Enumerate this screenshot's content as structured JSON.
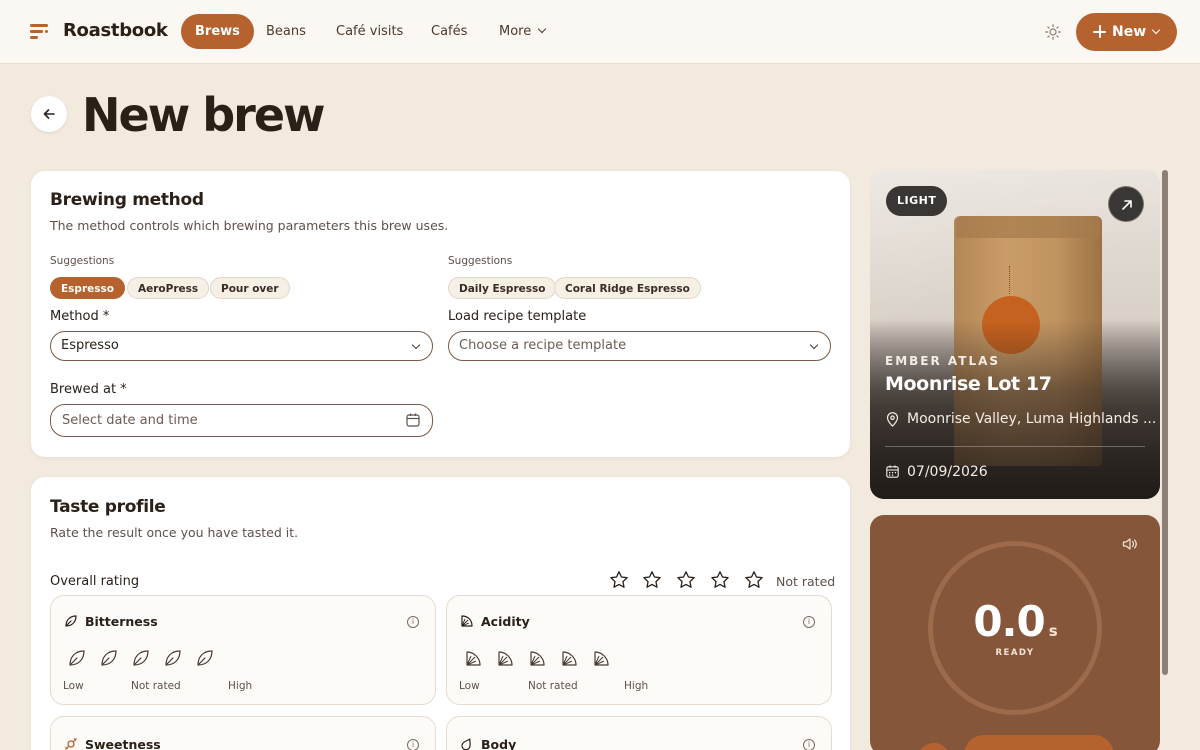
{
  "nav": {
    "brand": "Roastbook",
    "items": [
      {
        "label": "Brews",
        "active": true
      },
      {
        "label": "Beans",
        "active": false
      },
      {
        "label": "Café visits",
        "active": false
      },
      {
        "label": "Cafés",
        "active": false
      },
      {
        "label": "More",
        "active": false
      }
    ],
    "new_label": "New",
    "icons": [
      "logo-icon",
      "sun-icon",
      "plus-icon",
      "chevron-down-icon"
    ]
  },
  "page": {
    "title": "New brew",
    "back_icon": "arrow-left-icon"
  },
  "brewing": {
    "title": "Brewing method",
    "subtitle": "The method controls which brewing parameters this brew uses.",
    "method_suggestions_label": "Suggestions",
    "method_suggestions": [
      "Espresso",
      "AeroPress",
      "Pour over"
    ],
    "template_suggestions_label": "Suggestions",
    "template_suggestions": [
      "Daily Espresso",
      "Coral Ridge Espresso"
    ],
    "method_label": "Method *",
    "method_value": "Espresso",
    "template_label": "Load recipe template",
    "template_placeholder": "Choose a recipe template",
    "brewed_at_label": "Brewed at *",
    "brewed_at_placeholder": "Select date and time"
  },
  "taste": {
    "title": "Taste profile",
    "subtitle": "Rate the result once you have tasted it.",
    "overall_label": "Overall rating",
    "overall_status": "Not rated",
    "overall_stars": 0,
    "attributes": [
      {
        "name": "Bitterness",
        "icon": "leaf-icon",
        "low": "Low",
        "status": "Not rated",
        "high": "High"
      },
      {
        "name": "Acidity",
        "icon": "citrus-icon",
        "low": "Low",
        "status": "Not rated",
        "high": "High"
      },
      {
        "name": "Sweetness",
        "icon": "candy-icon"
      },
      {
        "name": "Body",
        "icon": "droplet-icon"
      }
    ]
  },
  "bean": {
    "roast_badge": "LIGHT",
    "roaster": "EMBER ATLAS",
    "name": "Moonrise Lot 17",
    "origin": "Moonrise Valley, Luma Highlands ...",
    "roast_date": "07/09/2026",
    "icons": [
      "external-link-icon",
      "map-pin-icon",
      "calendar-icon"
    ]
  },
  "timer": {
    "value": "0.0",
    "unit": "s",
    "status": "READY",
    "icon": "speaker-icon"
  },
  "colors": {
    "accent": "#b5622f",
    "background": "#f2e9df",
    "timer_bg": "#86563a"
  }
}
